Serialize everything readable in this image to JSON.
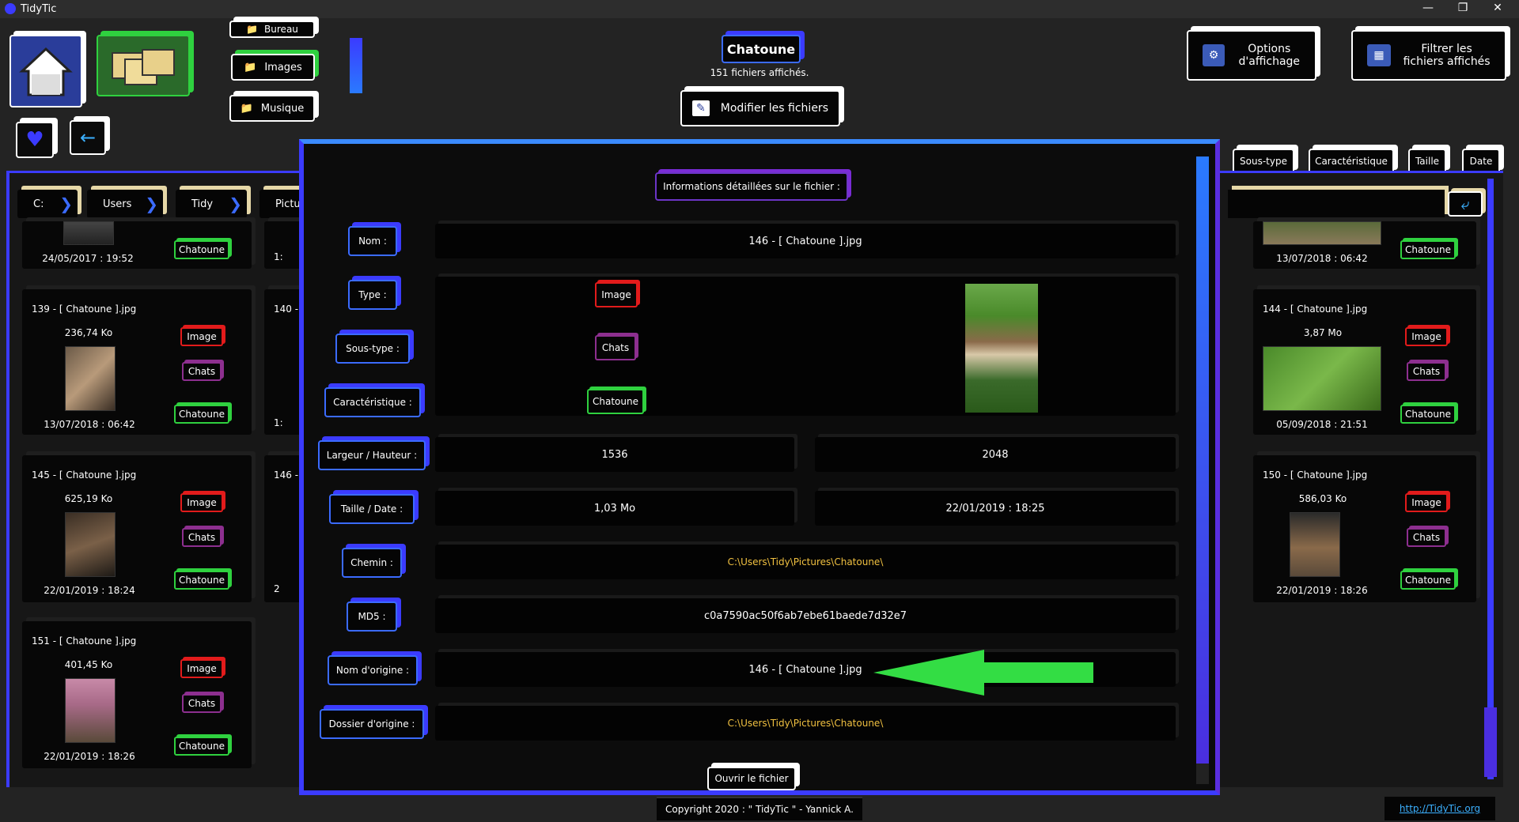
{
  "app": {
    "title": "TidyTic"
  },
  "folders": {
    "desktop": "Bureau",
    "images": "Images",
    "music": "Musique"
  },
  "header": {
    "collection": "Chatoune",
    "count_text": "151 fichiers affichés.",
    "edit_button": "Modifier les fichiers",
    "display_options": "Options d'affichage",
    "filter_files": "Filtrer les fichiers affichés"
  },
  "breadcrumb": [
    "C:",
    "Users",
    "Tidy",
    "Pictu"
  ],
  "columns": [
    "Sous-type",
    "Caractéristique",
    "Taille",
    "Date"
  ],
  "cards": [
    {
      "name": "",
      "size": "",
      "date": "24/05/2017 : 19:52",
      "tags": [
        "Chatoune"
      ]
    },
    {
      "name": "139 - [ Chatoune ].jpg",
      "size": "236,74 Ko",
      "date": "13/07/2018 : 06:42",
      "tags": [
        "Image",
        "Chats",
        "Chatoune"
      ]
    },
    {
      "name": "145 - [ Chatoune ].jpg",
      "size": "625,19 Ko",
      "date": "22/01/2019 : 18:24",
      "tags": [
        "Image",
        "Chats",
        "Chatoune"
      ]
    },
    {
      "name": "151 - [ Chatoune ].jpg",
      "size": "401,45 Ko",
      "date": "22/01/2019 : 18:26",
      "tags": [
        "Image",
        "Chats",
        "Chatoune"
      ]
    },
    {
      "name": "",
      "size": "",
      "date": "13/07/2018 : 06:42",
      "tags": [
        "Chatoune"
      ]
    },
    {
      "name": "144 - [ Chatoune ].jpg",
      "size": "3,87 Mo",
      "date": "05/09/2018 : 21:51",
      "tags": [
        "Image",
        "Chats",
        "Chatoune"
      ]
    },
    {
      "name": "150 - [ Chatoune ].jpg",
      "size": "586,03 Ko",
      "date": "22/01/2019 : 18:26",
      "tags": [
        "Image",
        "Chats",
        "Chatoune"
      ]
    }
  ],
  "partial": {
    "c140": "140 -",
    "c146": "146 -",
    "d1": "1:",
    "d2": "1:",
    "d3": "2"
  },
  "dialog": {
    "title": "Informations détaillées sur le fichier :",
    "labels": {
      "name": "Nom :",
      "type": "Type :",
      "subtype": "Sous-type :",
      "feature": "Caractéristique :",
      "dims": "Largeur / Hauteur :",
      "sizedate": "Taille / Date :",
      "path": "Chemin :",
      "md5": "MD5 :",
      "orig_name": "Nom d'origine :",
      "orig_dir": "Dossier d'origine :"
    },
    "values": {
      "name": "146 - [ Chatoune ].jpg",
      "type": "Image",
      "subtype": "Chats",
      "feature": "Chatoune",
      "width": "1536",
      "height": "2048",
      "size": "1,03 Mo",
      "date": "22/01/2019 : 18:25",
      "path": "C:\\Users\\Tidy\\Pictures\\Chatoune\\",
      "md5": "c0a7590ac50f6ab7ebe61baede7d32e7",
      "orig_name": "146 - [ Chatoune ].jpg",
      "orig_dir": "C:\\Users\\Tidy\\Pictures\\Chatoune\\"
    },
    "open_button": "Ouvrir le fichier"
  },
  "footer": {
    "copyright": "Copyright 2020 : \" TidyTic \" - Yannick A.",
    "link": "http://TidyTic.org"
  },
  "colors": {
    "accent": "#3b3bff",
    "path_text": "#f0c040",
    "arrow": "#33dd44"
  }
}
